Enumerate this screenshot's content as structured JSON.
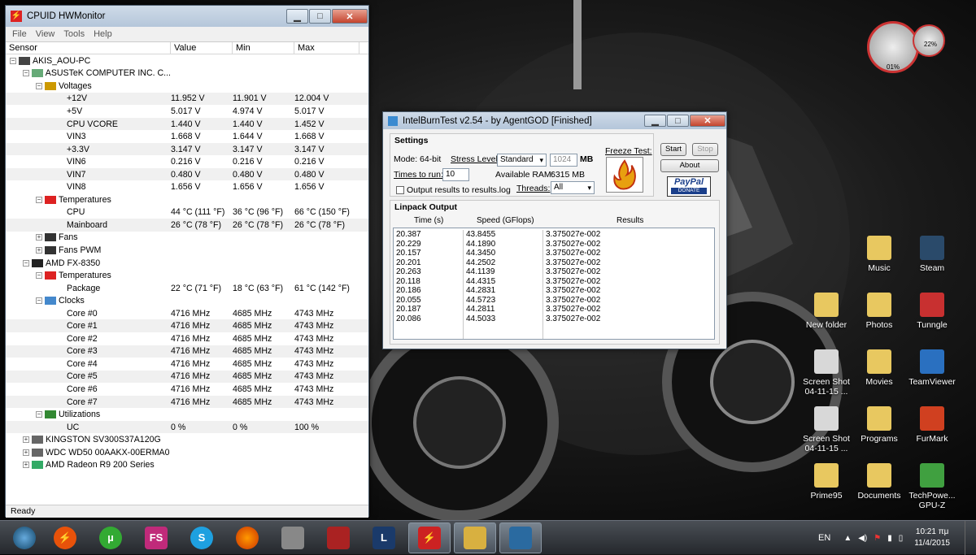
{
  "hwmonitor": {
    "title": "CPUID HWMonitor",
    "menu": [
      "File",
      "View",
      "Tools",
      "Help"
    ],
    "columns": [
      "Sensor",
      "Value",
      "Min",
      "Max"
    ],
    "rows": [
      {
        "d": 0,
        "e": "-",
        "n": "AKIS_AOU-PC",
        "v": "",
        "mi": "",
        "ma": "",
        "i": "pc"
      },
      {
        "d": 1,
        "e": "-",
        "n": "ASUSTeK COMPUTER INC. C...",
        "v": "",
        "mi": "",
        "ma": "",
        "i": "board"
      },
      {
        "d": 2,
        "e": "-",
        "n": "Voltages",
        "v": "",
        "mi": "",
        "ma": "",
        "i": "volt"
      },
      {
        "d": 3,
        "e": "",
        "n": "+12V",
        "v": "11.952 V",
        "mi": "11.901 V",
        "ma": "12.004 V"
      },
      {
        "d": 3,
        "e": "",
        "n": "+5V",
        "v": "5.017 V",
        "mi": "4.974 V",
        "ma": "5.017 V"
      },
      {
        "d": 3,
        "e": "",
        "n": "CPU VCORE",
        "v": "1.440 V",
        "mi": "1.440 V",
        "ma": "1.452 V"
      },
      {
        "d": 3,
        "e": "",
        "n": "VIN3",
        "v": "1.668 V",
        "mi": "1.644 V",
        "ma": "1.668 V"
      },
      {
        "d": 3,
        "e": "",
        "n": "+3.3V",
        "v": "3.147 V",
        "mi": "3.147 V",
        "ma": "3.147 V"
      },
      {
        "d": 3,
        "e": "",
        "n": "VIN6",
        "v": "0.216 V",
        "mi": "0.216 V",
        "ma": "0.216 V"
      },
      {
        "d": 3,
        "e": "",
        "n": "VIN7",
        "v": "0.480 V",
        "mi": "0.480 V",
        "ma": "0.480 V"
      },
      {
        "d": 3,
        "e": "",
        "n": "VIN8",
        "v": "1.656 V",
        "mi": "1.656 V",
        "ma": "1.656 V"
      },
      {
        "d": 2,
        "e": "-",
        "n": "Temperatures",
        "v": "",
        "mi": "",
        "ma": "",
        "i": "temp"
      },
      {
        "d": 3,
        "e": "",
        "n": "CPU",
        "v": "44 °C  (111 °F)",
        "mi": "36 °C  (96 °F)",
        "ma": "66 °C  (150 °F)"
      },
      {
        "d": 3,
        "e": "",
        "n": "Mainboard",
        "v": "26 °C  (78 °F)",
        "mi": "26 °C  (78 °F)",
        "ma": "26 °C  (78 °F)"
      },
      {
        "d": 2,
        "e": "+",
        "n": "Fans",
        "v": "",
        "mi": "",
        "ma": "",
        "i": "fan"
      },
      {
        "d": 2,
        "e": "+",
        "n": "Fans PWM",
        "v": "",
        "mi": "",
        "ma": "",
        "i": "fan"
      },
      {
        "d": 1,
        "e": "-",
        "n": "AMD FX-8350",
        "v": "",
        "mi": "",
        "ma": "",
        "i": "chip"
      },
      {
        "d": 2,
        "e": "-",
        "n": "Temperatures",
        "v": "",
        "mi": "",
        "ma": "",
        "i": "temp"
      },
      {
        "d": 3,
        "e": "",
        "n": "Package",
        "v": "22 °C  (71 °F)",
        "mi": "18 °C  (63 °F)",
        "ma": "61 °C  (142 °F)"
      },
      {
        "d": 2,
        "e": "-",
        "n": "Clocks",
        "v": "",
        "mi": "",
        "ma": "",
        "i": "clock"
      },
      {
        "d": 3,
        "e": "",
        "n": "Core #0",
        "v": "4716 MHz",
        "mi": "4685 MHz",
        "ma": "4743 MHz"
      },
      {
        "d": 3,
        "e": "",
        "n": "Core #1",
        "v": "4716 MHz",
        "mi": "4685 MHz",
        "ma": "4743 MHz"
      },
      {
        "d": 3,
        "e": "",
        "n": "Core #2",
        "v": "4716 MHz",
        "mi": "4685 MHz",
        "ma": "4743 MHz"
      },
      {
        "d": 3,
        "e": "",
        "n": "Core #3",
        "v": "4716 MHz",
        "mi": "4685 MHz",
        "ma": "4743 MHz"
      },
      {
        "d": 3,
        "e": "",
        "n": "Core #4",
        "v": "4716 MHz",
        "mi": "4685 MHz",
        "ma": "4743 MHz"
      },
      {
        "d": 3,
        "e": "",
        "n": "Core #5",
        "v": "4716 MHz",
        "mi": "4685 MHz",
        "ma": "4743 MHz"
      },
      {
        "d": 3,
        "e": "",
        "n": "Core #6",
        "v": "4716 MHz",
        "mi": "4685 MHz",
        "ma": "4743 MHz"
      },
      {
        "d": 3,
        "e": "",
        "n": "Core #7",
        "v": "4716 MHz",
        "mi": "4685 MHz",
        "ma": "4743 MHz"
      },
      {
        "d": 2,
        "e": "-",
        "n": "Utilizations",
        "v": "",
        "mi": "",
        "ma": "",
        "i": "util"
      },
      {
        "d": 3,
        "e": "",
        "n": "UC",
        "v": "0 %",
        "mi": "0 %",
        "ma": "100 %"
      },
      {
        "d": 1,
        "e": "+",
        "n": "KINGSTON  SV300S37A120G",
        "v": "",
        "mi": "",
        "ma": "",
        "i": "disk"
      },
      {
        "d": 1,
        "e": "+",
        "n": "WDC WD50 00AAKX-00ERMA0",
        "v": "",
        "mi": "",
        "ma": "",
        "i": "disk"
      },
      {
        "d": 1,
        "e": "+",
        "n": "AMD Radeon R9 200 Series",
        "v": "",
        "mi": "",
        "ma": "",
        "i": "gpu"
      }
    ],
    "status": "Ready"
  },
  "ibt": {
    "title": "IntelBurnTest v2.54 - by AgentGOD [Finished]",
    "settings_label": "Settings",
    "mode_label": "Mode:",
    "mode_value": "64-bit",
    "stress_label": "Stress Level:",
    "stress_value": "Standard",
    "mem_value": "1024",
    "mem_unit": "MB",
    "times_label": "Times to run:",
    "times_value": "10",
    "ram_label": "Available RAM:",
    "ram_value": "6315 MB",
    "threads_label": "Threads:",
    "threads_value": "All",
    "output_check_label": "Output results to results.log",
    "freeze_label": "Freeze Test:",
    "start": "Start",
    "stop": "Stop",
    "about": "About",
    "paypal": "PayPal",
    "donate": "DONATE",
    "linpack_label": "Linpack Output",
    "col_time": "Time (s)",
    "col_speed": "Speed (GFlops)",
    "col_results": "Results",
    "times": [
      "20.387",
      "20.229",
      "20.157",
      "20.201",
      "20.263",
      "20.118",
      "20.186",
      "20.055",
      "20.187",
      "20.086"
    ],
    "speeds": [
      "43.8455",
      "44.1890",
      "44.3450",
      "44.2502",
      "44.1139",
      "44.4315",
      "44.2831",
      "44.5723",
      "44.2811",
      "44.5033"
    ],
    "results": [
      "3.375027e-002",
      "3.375027e-002",
      "3.375027e-002",
      "3.375027e-002",
      "3.375027e-002",
      "3.375027e-002",
      "3.375027e-002",
      "3.375027e-002",
      "3.375027e-002",
      "3.375027e-002"
    ]
  },
  "gadget": {
    "cpu": "01%",
    "ram": "22%"
  },
  "desktop_icons": [
    {
      "label": "Music",
      "color": "#e8c860"
    },
    {
      "label": "Steam",
      "color": "#2a4a6a"
    },
    {
      "label": "New folder",
      "color": "#e8c860"
    },
    {
      "label": "Photos",
      "color": "#e8c860"
    },
    {
      "label": "Tunngle",
      "color": "#c83030"
    },
    {
      "label": "Screen Shot 04-11-15 ...",
      "color": "#d8d8d8"
    },
    {
      "label": "Movies",
      "color": "#e8c860"
    },
    {
      "label": "TeamViewer",
      "color": "#2a70c0"
    },
    {
      "label": "Screen Shot 04-11-15 ...",
      "color": "#d8d8d8"
    },
    {
      "label": "Programs",
      "color": "#e8c860"
    },
    {
      "label": "FurMark",
      "color": "#d04020"
    },
    {
      "label": "Prime95",
      "color": "#e8c860"
    },
    {
      "label": "Documents",
      "color": "#e8c860"
    },
    {
      "label": "TechPowe... GPU-Z",
      "color": "#40a040"
    }
  ],
  "taskbar": {
    "apps": [
      {
        "name": "start-orb",
        "text": ""
      },
      {
        "name": "cpuid-app",
        "text": "⚡"
      },
      {
        "name": "utorrent-app",
        "text": "µ"
      },
      {
        "name": "fs-app",
        "text": "FS"
      },
      {
        "name": "skype-app",
        "text": "S"
      },
      {
        "name": "firefox-app",
        "text": ""
      },
      {
        "name": "app-6",
        "text": ""
      },
      {
        "name": "gpu-tweak-app",
        "text": ""
      },
      {
        "name": "league-app",
        "text": "L"
      },
      {
        "name": "hwmonitor-app",
        "text": "⚡"
      },
      {
        "name": "explorer-app",
        "text": ""
      },
      {
        "name": "intelburntest-app",
        "text": ""
      }
    ],
    "lang": "EN",
    "time": "10:21 πμ",
    "date": "11/4/2015"
  }
}
